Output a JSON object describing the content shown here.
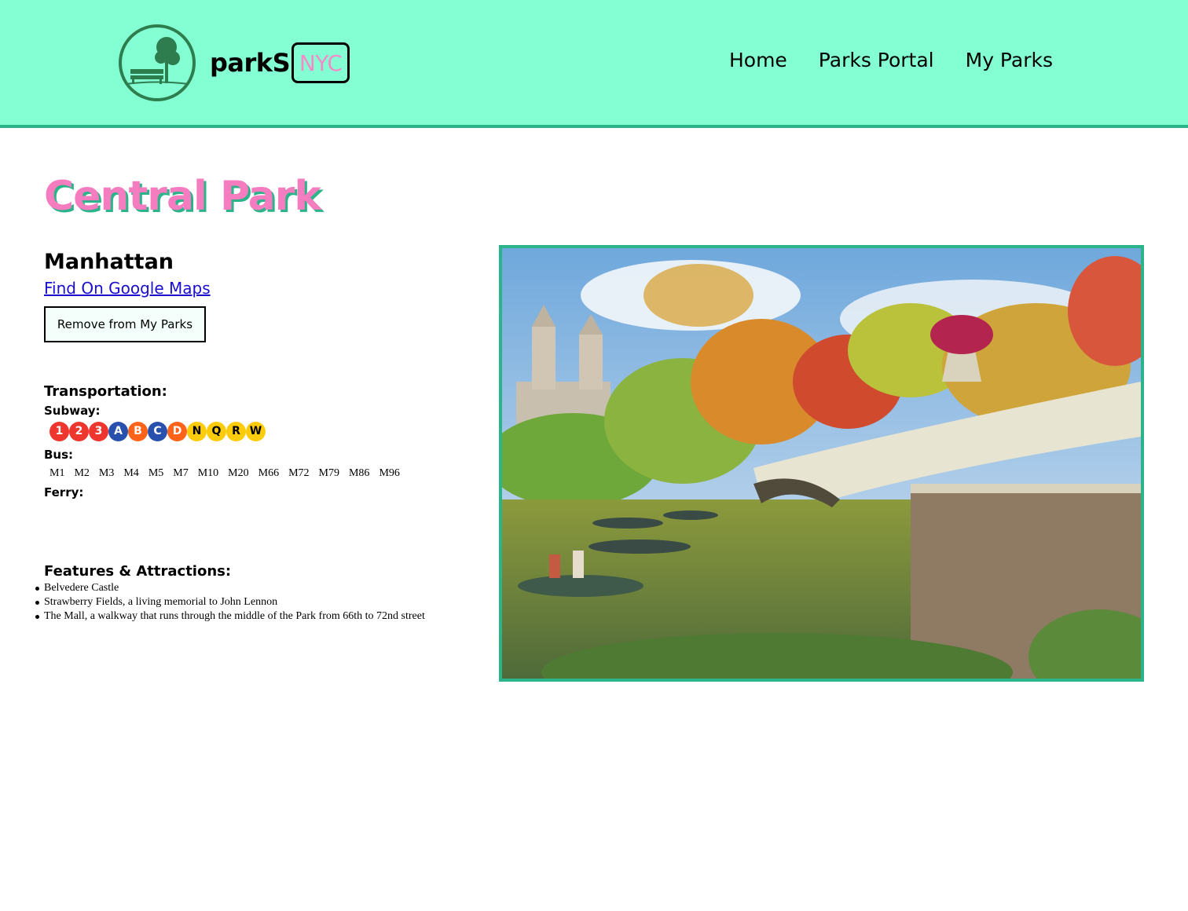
{
  "header": {
    "brand_prefix": "parkS",
    "brand_suffix": "NYC",
    "logo_icon": "park-tree-bench-icon",
    "nav": [
      {
        "label": "Home"
      },
      {
        "label": "Parks Portal"
      },
      {
        "label": "My Parks"
      }
    ]
  },
  "park": {
    "name": "Central Park",
    "borough": "Manhattan",
    "maps_link": "Find On Google Maps",
    "remove_button": "Remove from My Parks",
    "photo_icon": "park-photo-bow-bridge"
  },
  "transportation": {
    "title": "Transportation:",
    "subway_label": "Subway:",
    "subway_lines": [
      {
        "line": "1",
        "color": "#ee352e"
      },
      {
        "line": "2",
        "color": "#ee352e"
      },
      {
        "line": "3",
        "color": "#ee352e"
      },
      {
        "line": "A",
        "color": "#2850ad"
      },
      {
        "line": "B",
        "color": "#ff6319"
      },
      {
        "line": "C",
        "color": "#2850ad"
      },
      {
        "line": "D",
        "color": "#ff6319"
      },
      {
        "line": "N",
        "color": "#fccc0a"
      },
      {
        "line": "Q",
        "color": "#fccc0a"
      },
      {
        "line": "R",
        "color": "#fccc0a"
      },
      {
        "line": "W",
        "color": "#fccc0a"
      }
    ],
    "bus_label": "Bus:",
    "bus_lines": [
      "M1",
      "M2",
      "M3",
      "M4",
      "M5",
      "M7",
      "M10",
      "M20",
      "M66",
      "M72",
      "M79",
      "M86",
      "M96"
    ],
    "ferry_label": "Ferry:"
  },
  "features": {
    "title": "Features & Attractions:",
    "items": [
      "Belvedere Castle",
      "Strawberry Fields, a living memorial to John Lennon",
      "The Mall, a walkway that runs through the middle of the Park from 66th to 72nd street"
    ]
  },
  "colors": {
    "header_bg": "#84ffd3",
    "accent_green": "#2bb38a",
    "accent_pink": "#f47cbf",
    "link_blue": "#1a0dcc"
  }
}
